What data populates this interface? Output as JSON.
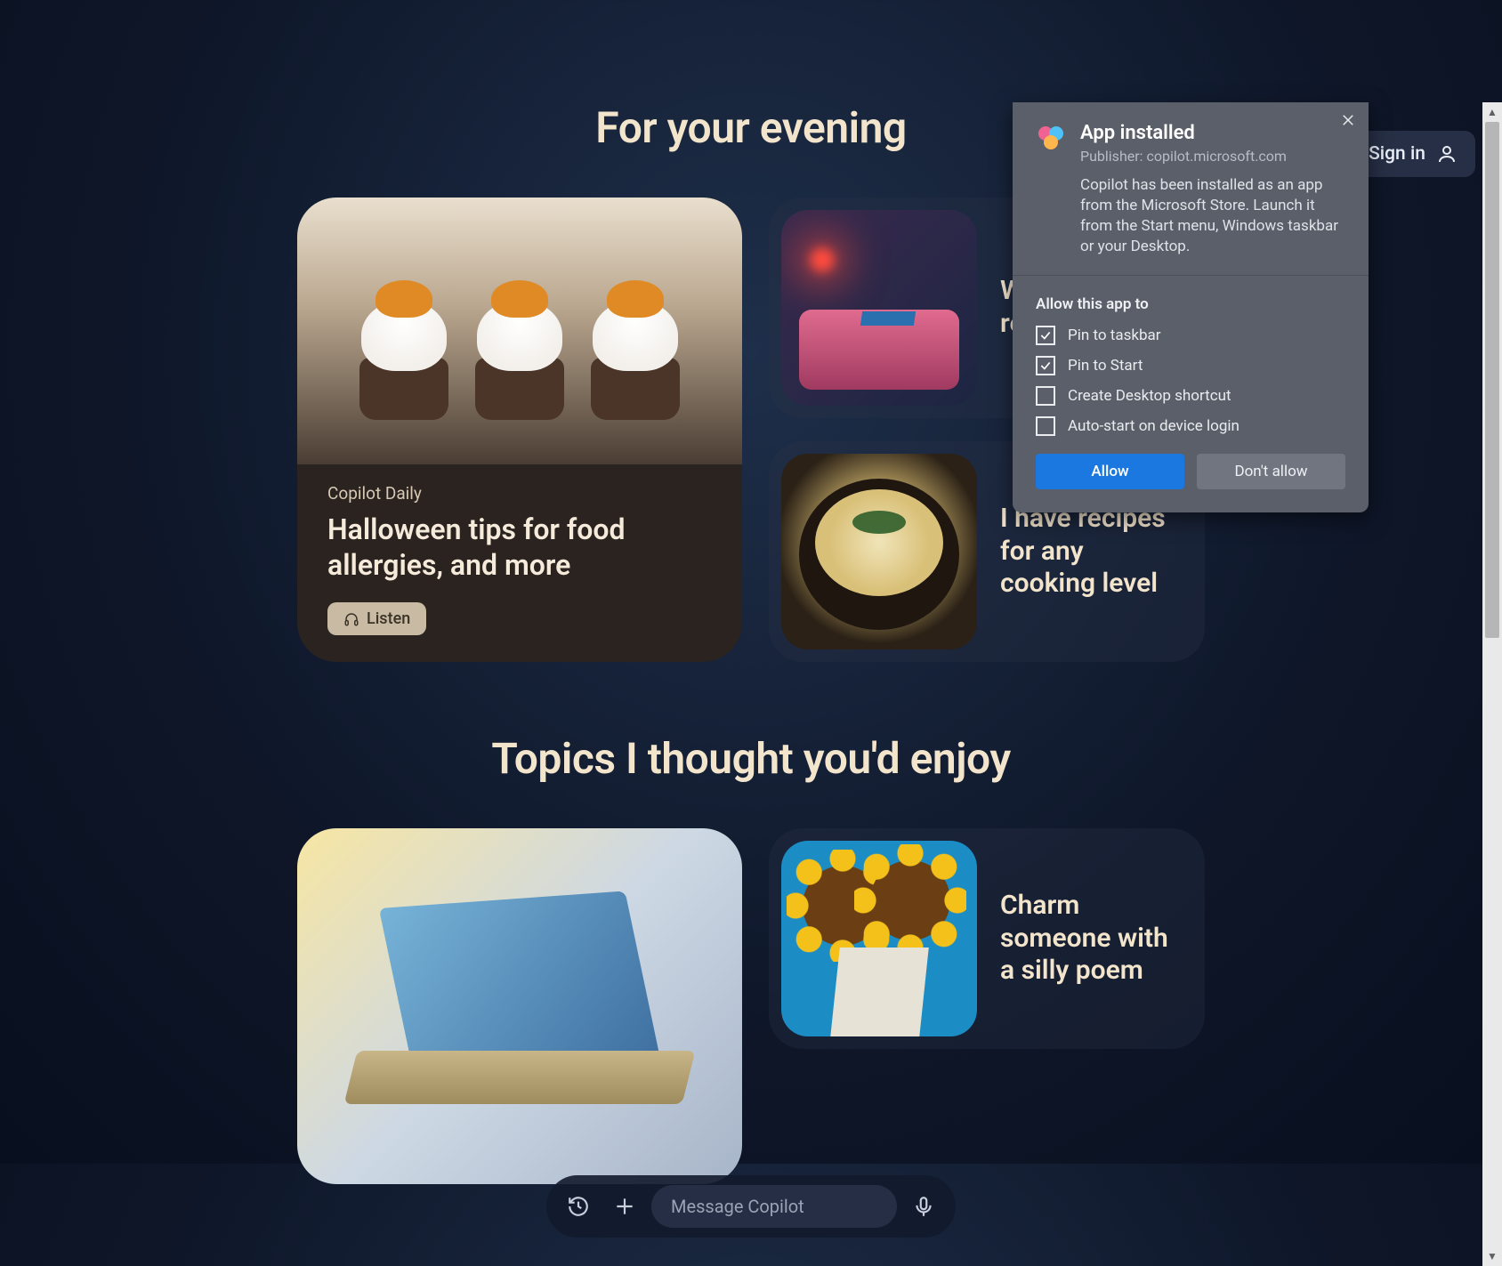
{
  "header": {
    "signin_label": "Sign in"
  },
  "sections": {
    "evening_heading": "For your evening",
    "topics_heading": "Topics I thought you'd enjoy"
  },
  "feature_card": {
    "eyebrow": "Copilot Daily",
    "title": "Halloween tips for food allergies, and more",
    "listen_label": "Listen"
  },
  "mini_cards": {
    "bedtime": "Wind down and relax",
    "recipes": "I have recipes for any cooking level",
    "poem": "Charm someone with a silly poem"
  },
  "composer": {
    "placeholder": "Message Copilot"
  },
  "dialog": {
    "title": "App installed",
    "publisher": "Publisher: copilot.microsoft.com",
    "description": "Copilot has been installed as an app from the Microsoft Store. Launch it from the Start menu, Windows taskbar or your Desktop.",
    "allow_heading": "Allow this app to",
    "options": {
      "pin_taskbar": {
        "label": "Pin to taskbar",
        "checked": true
      },
      "pin_start": {
        "label": "Pin to Start",
        "checked": true
      },
      "desktop": {
        "label": "Create Desktop shortcut",
        "checked": false
      },
      "autostart": {
        "label": "Auto-start on device login",
        "checked": false
      }
    },
    "allow_btn": "Allow",
    "deny_btn": "Don't allow"
  }
}
